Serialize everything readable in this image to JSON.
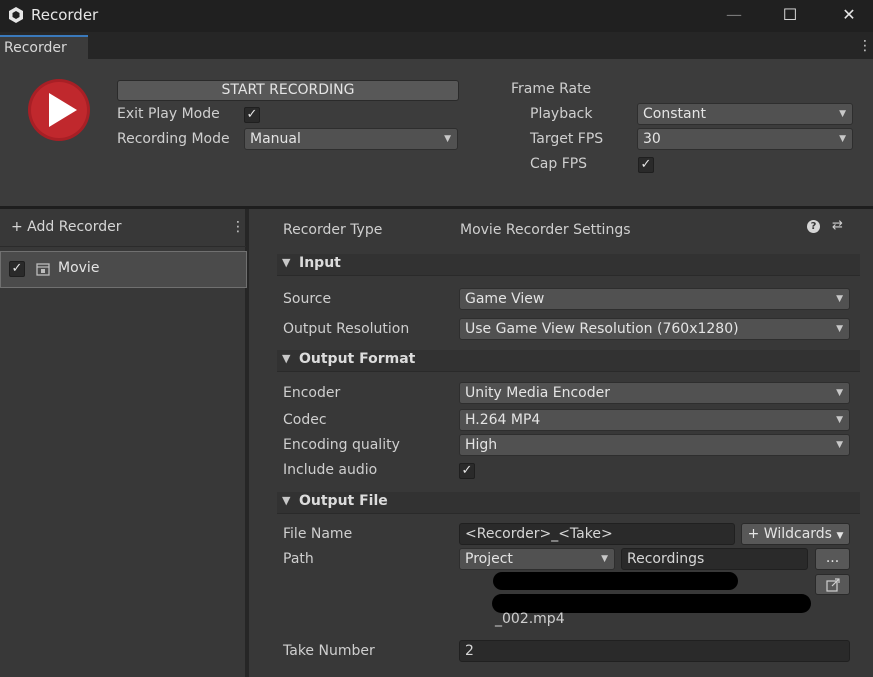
{
  "window": {
    "title": "Recorder",
    "minimize": "—",
    "maximize": "☐",
    "close": "✕"
  },
  "tab": {
    "label": "Recorder",
    "menu": "⋮"
  },
  "top": {
    "start_button": "START RECORDING",
    "exit_play_mode_label": "Exit Play Mode",
    "exit_play_mode_checked": true,
    "recording_mode_label": "Recording Mode",
    "recording_mode_value": "Manual",
    "frame_rate_label": "Frame Rate",
    "playback_label": "Playback",
    "playback_value": "Constant",
    "target_fps_label": "Target FPS",
    "target_fps_value": "30",
    "cap_fps_label": "Cap FPS",
    "cap_fps_checked": true
  },
  "left": {
    "add_recorder": "+ Add Recorder",
    "menu": "⋮",
    "recorders": [
      {
        "name": "Movie",
        "enabled": true
      }
    ]
  },
  "right": {
    "recorder_type_label": "Recorder Type",
    "recorder_type_value": "Movie Recorder Settings",
    "help_icon": "?",
    "presets_icon": "⇄",
    "input": {
      "title": "Input",
      "source_label": "Source",
      "source_value": "Game View",
      "resolution_label": "Output Resolution",
      "resolution_value": "Use Game View Resolution (760x1280)"
    },
    "output_format": {
      "title": "Output Format",
      "encoder_label": "Encoder",
      "encoder_value": "Unity Media Encoder",
      "codec_label": "Codec",
      "codec_value": "H.264 MP4",
      "quality_label": "Encoding quality",
      "quality_value": "High",
      "audio_label": "Include audio",
      "audio_checked": true
    },
    "output_file": {
      "title": "Output File",
      "file_name_label": "File Name",
      "file_name_value": "<Recorder>_<Take>",
      "wildcards_button": "+ Wildcards",
      "path_label": "Path",
      "path_root": "Project",
      "path_folder": "Recordings",
      "browse_button": "...",
      "path_tail": "_002.mp4",
      "take_label": "Take Number",
      "take_value": "2"
    }
  },
  "colors": {
    "record_red": "#c0282d",
    "accent_tab": "#3a79bb"
  }
}
